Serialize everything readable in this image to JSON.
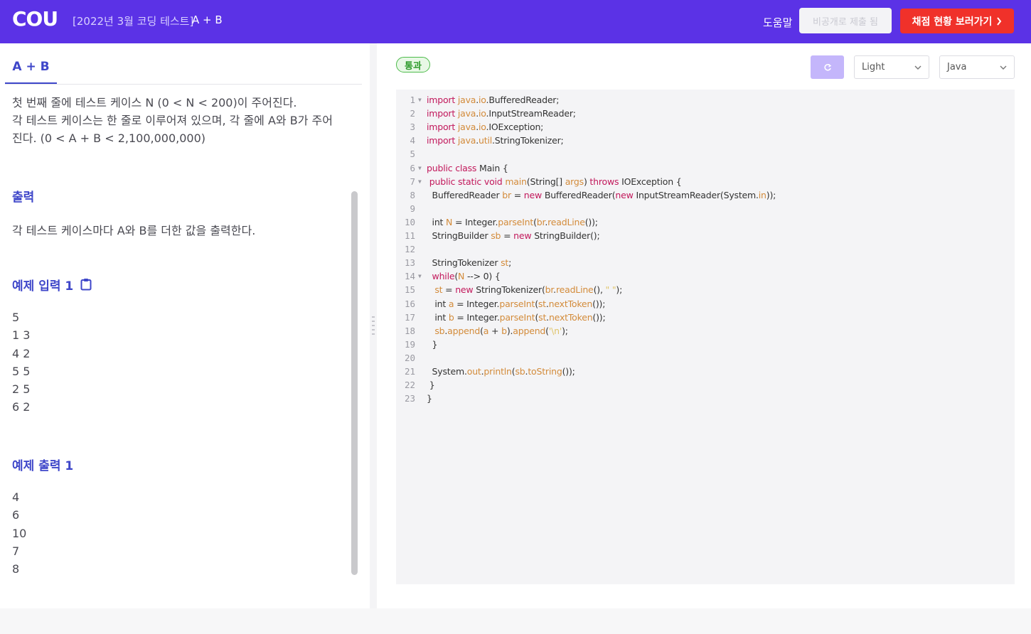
{
  "header": {
    "logo": "COU",
    "breadcrumb": "[2022년 3월 코딩 테스트]",
    "problem_title": "A + B",
    "help_label": "도움말",
    "private_button": "비공개로 제출 됨",
    "grade_button": "채점 현황 보러가기"
  },
  "problem": {
    "tab_label": "A + B",
    "description_lines": [
      "첫 번째 줄에 테스트 케이스 N (0 < N < 200)이 주어진다.",
      "각 테스트 케이스는 한 줄로 이루어져 있으며, 각 줄에 A와 B가 주어",
      "진다. (0 < A + B < 2,100,000,000)"
    ],
    "output_title": "출력",
    "output_text": "각 테스트 케이스마다 A와 B를 더한 값을 출력한다.",
    "sample_input_title": "예제 입력 1",
    "sample_input_lines": [
      "5",
      "1 3",
      "4 2",
      "5 5",
      "2 5",
      "6 2"
    ],
    "sample_output_title": "예제 출력 1",
    "sample_output_lines": [
      "4",
      "6",
      "10",
      "7",
      "8"
    ]
  },
  "editor": {
    "status_badge": "통과",
    "theme": "Light",
    "language": "Java",
    "colors": {
      "keyword": "#c2185b",
      "type": "#d38b3a",
      "string": "#e0c46a"
    },
    "code_lines": [
      "import java.io.BufferedReader;",
      "import java.io.InputStreamReader;",
      "import java.io.IOException;",
      "import java.util.StringTokenizer;",
      "",
      "public class Main {",
      " public static void main(String[] args) throws IOException {",
      "  BufferedReader br = new BufferedReader(new InputStreamReader(System.in));",
      "",
      "  int N = Integer.parseInt(br.readLine());",
      "  StringBuilder sb = new StringBuilder();",
      "",
      "  StringTokenizer st;",
      "  while(N --> 0) {",
      "   st = new StringTokenizer(br.readLine(), \" \");",
      "   int a = Integer.parseInt(st.nextToken());",
      "   int b = Integer.parseInt(st.nextToken());",
      "   sb.append(a + b).append('\\n');",
      "  }",
      "",
      "  System.out.println(sb.toString());",
      " }",
      "}"
    ]
  },
  "icons": {
    "clipboard": "clipboard-icon",
    "refresh": "refresh-icon",
    "chevron_right": "chevron-right-icon",
    "chevron_down": "chevron-down-icon",
    "fold": "fold-arrow-icon",
    "drag": "drag-handle-icon"
  }
}
